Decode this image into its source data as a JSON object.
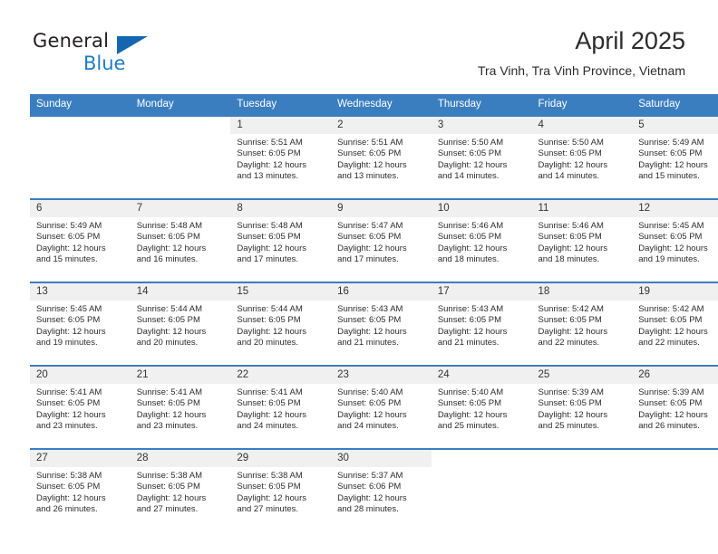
{
  "brand": {
    "name_part1": "General",
    "name_part2": "Blue",
    "triangle_icon": "triangle-icon",
    "accent_color": "#1d7cc4",
    "header_color": "#3a7ec0"
  },
  "header": {
    "title": "April 2025",
    "subtitle": "Tra Vinh, Tra Vinh Province, Vietnam"
  },
  "calendar": {
    "weekday_headers": [
      "Sunday",
      "Monday",
      "Tuesday",
      "Wednesday",
      "Thursday",
      "Friday",
      "Saturday"
    ],
    "weeks": [
      [
        {
          "day": "",
          "empty": true
        },
        {
          "day": "",
          "empty": true
        },
        {
          "day": "1",
          "sunrise": "Sunrise: 5:51 AM",
          "sunset": "Sunset: 6:05 PM",
          "daylight_line1": "Daylight: 12 hours",
          "daylight_line2": "and 13 minutes."
        },
        {
          "day": "2",
          "sunrise": "Sunrise: 5:51 AM",
          "sunset": "Sunset: 6:05 PM",
          "daylight_line1": "Daylight: 12 hours",
          "daylight_line2": "and 13 minutes."
        },
        {
          "day": "3",
          "sunrise": "Sunrise: 5:50 AM",
          "sunset": "Sunset: 6:05 PM",
          "daylight_line1": "Daylight: 12 hours",
          "daylight_line2": "and 14 minutes."
        },
        {
          "day": "4",
          "sunrise": "Sunrise: 5:50 AM",
          "sunset": "Sunset: 6:05 PM",
          "daylight_line1": "Daylight: 12 hours",
          "daylight_line2": "and 14 minutes."
        },
        {
          "day": "5",
          "sunrise": "Sunrise: 5:49 AM",
          "sunset": "Sunset: 6:05 PM",
          "daylight_line1": "Daylight: 12 hours",
          "daylight_line2": "and 15 minutes."
        }
      ],
      [
        {
          "day": "6",
          "sunrise": "Sunrise: 5:49 AM",
          "sunset": "Sunset: 6:05 PM",
          "daylight_line1": "Daylight: 12 hours",
          "daylight_line2": "and 15 minutes."
        },
        {
          "day": "7",
          "sunrise": "Sunrise: 5:48 AM",
          "sunset": "Sunset: 6:05 PM",
          "daylight_line1": "Daylight: 12 hours",
          "daylight_line2": "and 16 minutes."
        },
        {
          "day": "8",
          "sunrise": "Sunrise: 5:48 AM",
          "sunset": "Sunset: 6:05 PM",
          "daylight_line1": "Daylight: 12 hours",
          "daylight_line2": "and 17 minutes."
        },
        {
          "day": "9",
          "sunrise": "Sunrise: 5:47 AM",
          "sunset": "Sunset: 6:05 PM",
          "daylight_line1": "Daylight: 12 hours",
          "daylight_line2": "and 17 minutes."
        },
        {
          "day": "10",
          "sunrise": "Sunrise: 5:46 AM",
          "sunset": "Sunset: 6:05 PM",
          "daylight_line1": "Daylight: 12 hours",
          "daylight_line2": "and 18 minutes."
        },
        {
          "day": "11",
          "sunrise": "Sunrise: 5:46 AM",
          "sunset": "Sunset: 6:05 PM",
          "daylight_line1": "Daylight: 12 hours",
          "daylight_line2": "and 18 minutes."
        },
        {
          "day": "12",
          "sunrise": "Sunrise: 5:45 AM",
          "sunset": "Sunset: 6:05 PM",
          "daylight_line1": "Daylight: 12 hours",
          "daylight_line2": "and 19 minutes."
        }
      ],
      [
        {
          "day": "13",
          "sunrise": "Sunrise: 5:45 AM",
          "sunset": "Sunset: 6:05 PM",
          "daylight_line1": "Daylight: 12 hours",
          "daylight_line2": "and 19 minutes."
        },
        {
          "day": "14",
          "sunrise": "Sunrise: 5:44 AM",
          "sunset": "Sunset: 6:05 PM",
          "daylight_line1": "Daylight: 12 hours",
          "daylight_line2": "and 20 minutes."
        },
        {
          "day": "15",
          "sunrise": "Sunrise: 5:44 AM",
          "sunset": "Sunset: 6:05 PM",
          "daylight_line1": "Daylight: 12 hours",
          "daylight_line2": "and 20 minutes."
        },
        {
          "day": "16",
          "sunrise": "Sunrise: 5:43 AM",
          "sunset": "Sunset: 6:05 PM",
          "daylight_line1": "Daylight: 12 hours",
          "daylight_line2": "and 21 minutes."
        },
        {
          "day": "17",
          "sunrise": "Sunrise: 5:43 AM",
          "sunset": "Sunset: 6:05 PM",
          "daylight_line1": "Daylight: 12 hours",
          "daylight_line2": "and 21 minutes."
        },
        {
          "day": "18",
          "sunrise": "Sunrise: 5:42 AM",
          "sunset": "Sunset: 6:05 PM",
          "daylight_line1": "Daylight: 12 hours",
          "daylight_line2": "and 22 minutes."
        },
        {
          "day": "19",
          "sunrise": "Sunrise: 5:42 AM",
          "sunset": "Sunset: 6:05 PM",
          "daylight_line1": "Daylight: 12 hours",
          "daylight_line2": "and 22 minutes."
        }
      ],
      [
        {
          "day": "20",
          "sunrise": "Sunrise: 5:41 AM",
          "sunset": "Sunset: 6:05 PM",
          "daylight_line1": "Daylight: 12 hours",
          "daylight_line2": "and 23 minutes."
        },
        {
          "day": "21",
          "sunrise": "Sunrise: 5:41 AM",
          "sunset": "Sunset: 6:05 PM",
          "daylight_line1": "Daylight: 12 hours",
          "daylight_line2": "and 23 minutes."
        },
        {
          "day": "22",
          "sunrise": "Sunrise: 5:41 AM",
          "sunset": "Sunset: 6:05 PM",
          "daylight_line1": "Daylight: 12 hours",
          "daylight_line2": "and 24 minutes."
        },
        {
          "day": "23",
          "sunrise": "Sunrise: 5:40 AM",
          "sunset": "Sunset: 6:05 PM",
          "daylight_line1": "Daylight: 12 hours",
          "daylight_line2": "and 24 minutes."
        },
        {
          "day": "24",
          "sunrise": "Sunrise: 5:40 AM",
          "sunset": "Sunset: 6:05 PM",
          "daylight_line1": "Daylight: 12 hours",
          "daylight_line2": "and 25 minutes."
        },
        {
          "day": "25",
          "sunrise": "Sunrise: 5:39 AM",
          "sunset": "Sunset: 6:05 PM",
          "daylight_line1": "Daylight: 12 hours",
          "daylight_line2": "and 25 minutes."
        },
        {
          "day": "26",
          "sunrise": "Sunrise: 5:39 AM",
          "sunset": "Sunset: 6:05 PM",
          "daylight_line1": "Daylight: 12 hours",
          "daylight_line2": "and 26 minutes."
        }
      ],
      [
        {
          "day": "27",
          "sunrise": "Sunrise: 5:38 AM",
          "sunset": "Sunset: 6:05 PM",
          "daylight_line1": "Daylight: 12 hours",
          "daylight_line2": "and 26 minutes."
        },
        {
          "day": "28",
          "sunrise": "Sunrise: 5:38 AM",
          "sunset": "Sunset: 6:05 PM",
          "daylight_line1": "Daylight: 12 hours",
          "daylight_line2": "and 27 minutes."
        },
        {
          "day": "29",
          "sunrise": "Sunrise: 5:38 AM",
          "sunset": "Sunset: 6:05 PM",
          "daylight_line1": "Daylight: 12 hours",
          "daylight_line2": "and 27 minutes."
        },
        {
          "day": "30",
          "sunrise": "Sunrise: 5:37 AM",
          "sunset": "Sunset: 6:06 PM",
          "daylight_line1": "Daylight: 12 hours",
          "daylight_line2": "and 28 minutes."
        },
        {
          "day": "",
          "empty": true
        },
        {
          "day": "",
          "empty": true
        },
        {
          "day": "",
          "empty": true
        }
      ]
    ]
  }
}
